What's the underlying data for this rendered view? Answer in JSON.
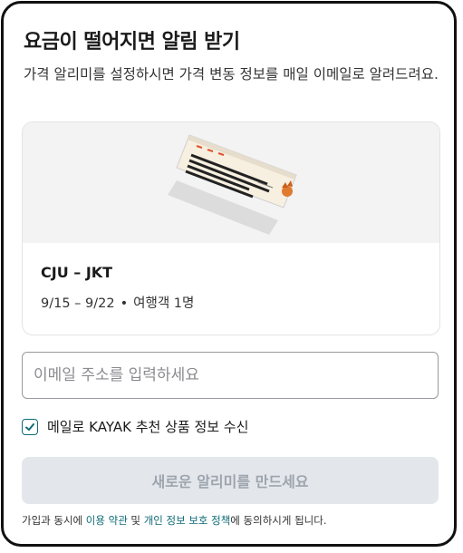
{
  "modal": {
    "title": "요금이 떨어지면 알림 받기",
    "description": "가격 알리미를 설정하시면 가격 변동 정보를 매일 이메일로 알려드려요."
  },
  "trip": {
    "route": "CJU – JKT",
    "dates": "9/15 – 9/22",
    "separator": "•",
    "travelers": "여행객 1명"
  },
  "email": {
    "placeholder": "이메일 주소를 입력하세요"
  },
  "opt_in": {
    "checked": true,
    "label": "메일로 KAYAK 추천 상품 정보 수신"
  },
  "submit": {
    "label": "새로운 알리미를 만드세요"
  },
  "terms": {
    "prefix": "가입과 동시에 ",
    "terms_link": "이용 약관",
    "and": " 및 ",
    "privacy_link": "개인 정보 보호 정책",
    "suffix": "에 동의하시게 됩니다."
  },
  "colors": {
    "accent": "#0f6b78",
    "button_bg": "#e3e7ec",
    "button_text": "#9da4ad",
    "illustration_bg": "#f3f3f4"
  }
}
